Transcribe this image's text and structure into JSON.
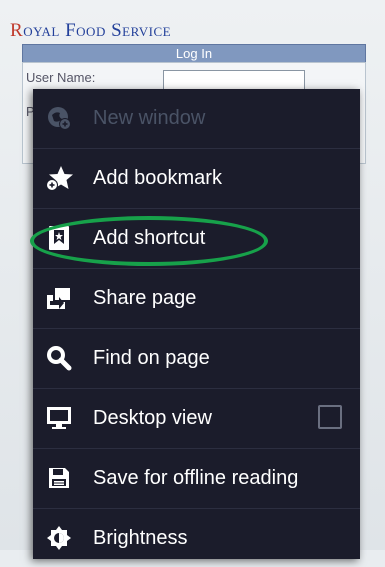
{
  "page": {
    "brand_initial": "R",
    "brand_rest": "oyal Food Service",
    "login_title": "Log In",
    "user_label": "User Name:",
    "password_label_partial": "P"
  },
  "menu": {
    "items": [
      {
        "label": "New window",
        "icon": "new-window-icon",
        "enabled": false
      },
      {
        "label": "Add bookmark",
        "icon": "add-bookmark-icon",
        "enabled": true
      },
      {
        "label": "Add shortcut",
        "icon": "add-shortcut-icon",
        "enabled": true,
        "highlighted": true
      },
      {
        "label": "Share page",
        "icon": "share-icon",
        "enabled": true
      },
      {
        "label": "Find on page",
        "icon": "search-icon",
        "enabled": true
      },
      {
        "label": "Desktop view",
        "icon": "monitor-icon",
        "enabled": true,
        "checkbox": false
      },
      {
        "label": "Save for offline reading",
        "icon": "save-icon",
        "enabled": true
      },
      {
        "label": "Brightness",
        "icon": "brightness-icon",
        "enabled": true
      }
    ]
  },
  "colors": {
    "menu_bg": "#1b1c2b",
    "highlight": "#17a14a",
    "brand": "#23409a"
  }
}
